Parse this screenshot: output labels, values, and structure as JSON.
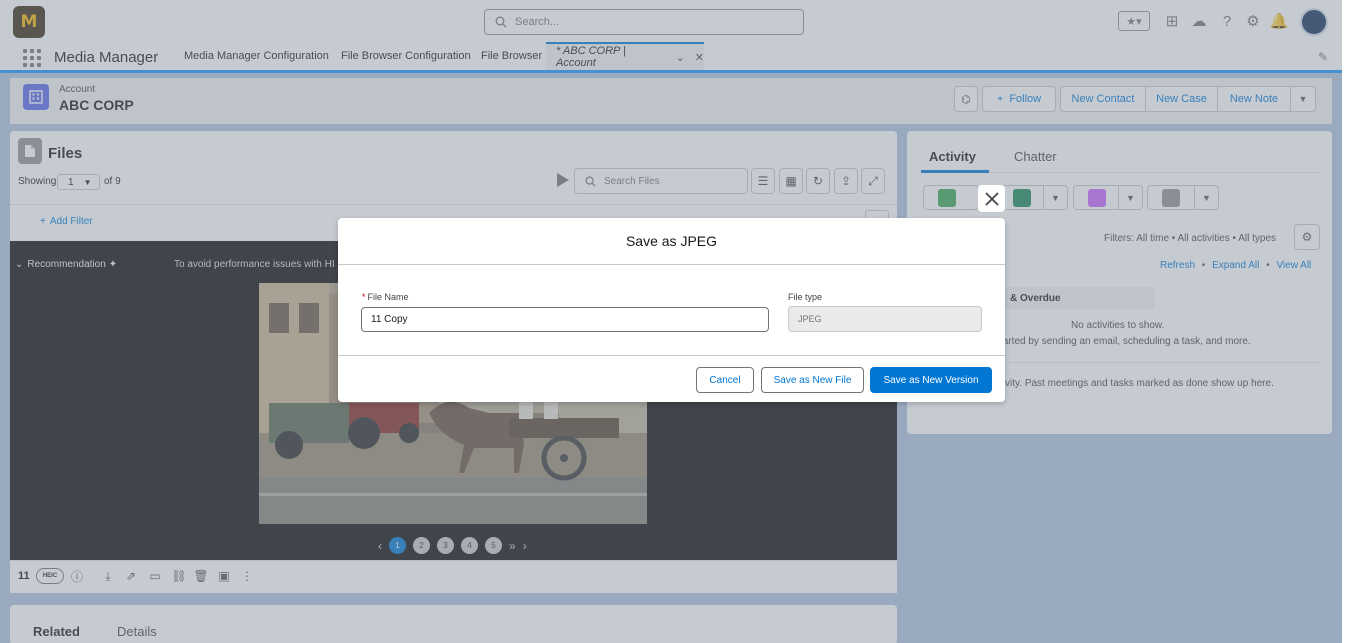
{
  "header": {
    "logo_text": "M",
    "search_placeholder": "Search...",
    "icons": [
      "favorites-icon",
      "add-icon",
      "trailhead-icon",
      "help-icon",
      "setup-gear-icon",
      "notifications-bell-icon",
      "avatar"
    ]
  },
  "nav": {
    "app_name": "Media Manager",
    "tabs": [
      {
        "label": "Media Manager Configuration"
      },
      {
        "label": "File Browser Configuration"
      },
      {
        "label": "File Browser"
      }
    ],
    "active_tab": {
      "label": "* ABC CORP | Account"
    }
  },
  "record": {
    "type": "Account",
    "name": "ABC CORP",
    "buttons": {
      "follow": "Follow",
      "new_contact": "New Contact",
      "new_case": "New Case",
      "new_note": "New Note"
    }
  },
  "files": {
    "title": "Files",
    "showing_label": "Showing",
    "showing_value": "1",
    "of_count": "of 9",
    "search_placeholder": "Search Files",
    "add_filter": "Add Filter",
    "recommendation": "Recommendation",
    "perf_warning": "To avoid performance issues with HI",
    "pages": [
      "1",
      "2",
      "3",
      "4",
      "5"
    ],
    "current_page": "1",
    "file_number": "11",
    "file_badge": "HEIC"
  },
  "related": {
    "tab_related": "Related",
    "tab_details": "Details"
  },
  "activity": {
    "tab_activity": "Activity",
    "tab_chatter": "Chatter",
    "filters_text": "Filters: All time • All activities • All types",
    "links": {
      "refresh": "Refresh",
      "expand_all": "Expand All",
      "view_all": "View All"
    },
    "overdue": "& Overdue",
    "no_activities": "No activities to show.",
    "get_started": "tarted by sending an email, scheduling a task, and more.",
    "past_activity": "tivity. Past meetings and tasks marked as done show up here.",
    "colors": {
      "task": "#3ba755",
      "call": "#1b8a5a",
      "event": "#cb65ff",
      "email": "#939393"
    }
  },
  "modal": {
    "title": "Save as JPEG",
    "file_name_label": "File Name",
    "required_marker": "*",
    "file_name_value": "11 Copy",
    "file_type_label": "File type",
    "file_type_value": "JPEG",
    "cancel": "Cancel",
    "save_new_file": "Save as New File",
    "save_new_version": "Save as New Version"
  },
  "colors": {
    "brand": "#0176d3",
    "header_bar": "#1b96ff"
  }
}
